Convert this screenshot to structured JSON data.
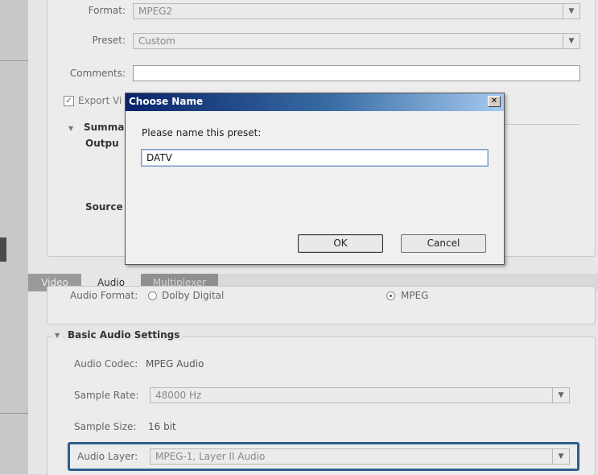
{
  "export_panel": {
    "format_label": "Format:",
    "format_value": "MPEG2",
    "preset_label": "Preset:",
    "preset_value": "Custom",
    "comments_label": "Comments:",
    "comments_value": "",
    "export_video_label": "Export Vi",
    "export_video_checked": true,
    "summary_label": "Summa",
    "output_label": "Outpu",
    "source_label": "Source"
  },
  "tabs": [
    {
      "label": "Video",
      "active": false
    },
    {
      "label": "Audio",
      "active": true
    },
    {
      "label": "Multiplexer",
      "active": false
    }
  ],
  "audio_format": {
    "label": "Audio Format:",
    "options": [
      "Dolby Digital",
      "MPEG"
    ],
    "selected": "MPEG"
  },
  "basic_audio": {
    "section_title": "Basic Audio Settings",
    "codec_label": "Audio Codec:",
    "codec_value": "MPEG Audio",
    "sample_rate_label": "Sample Rate:",
    "sample_rate_value": "48000 Hz",
    "sample_size_label": "Sample Size:",
    "sample_size_value": "16 bit",
    "layer_label": "Audio Layer:",
    "layer_value": "MPEG-1, Layer II Audio"
  },
  "dialog": {
    "title": "Choose Name",
    "close_glyph": "✕",
    "prompt": "Please name this preset:",
    "input_value": "DATV",
    "ok_label": "OK",
    "cancel_label": "Cancel"
  },
  "icons": {
    "dropdown_arrow": "▼",
    "triangle_expanded": "▼",
    "checkmark": "✓"
  },
  "colors": {
    "highlight_border": "#2d5d8f",
    "title_bar_start": "#0a246a",
    "title_bar_end": "#a6caf0"
  }
}
